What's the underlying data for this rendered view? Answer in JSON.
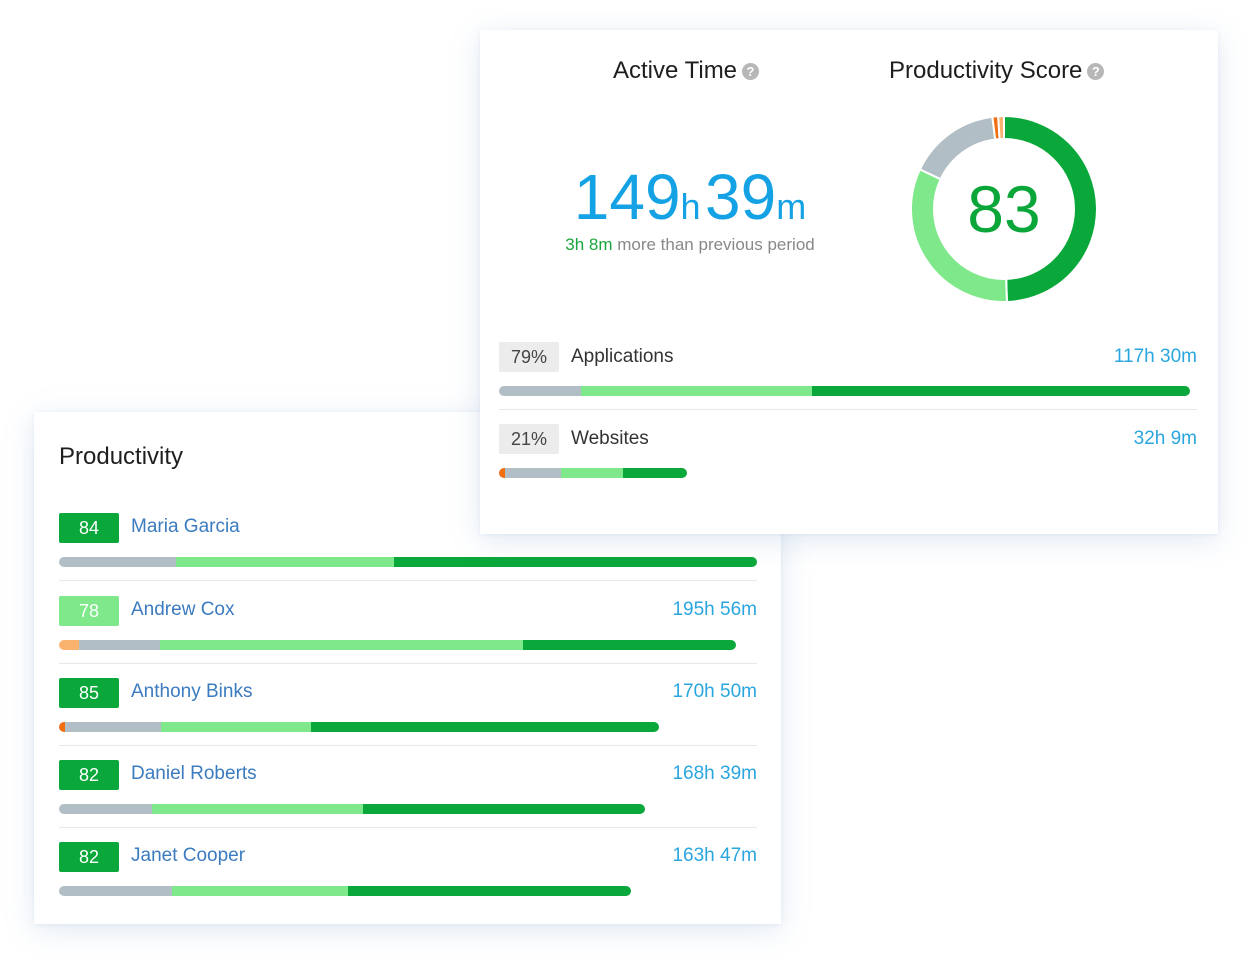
{
  "colors": {
    "neutral": "#b1bec5",
    "productive_light": "#7ee88a",
    "productive_dark": "#0aa83a",
    "unproductive_light": "#f9b36f",
    "unproductive_dark": "#f06e14",
    "accent_blue": "#2aa6df"
  },
  "productivity": {
    "title": "Productivity",
    "users": [
      {
        "score": "84",
        "score_level": "high",
        "name": "Maria Garcia",
        "time": "",
        "bar": {
          "total": 1.0,
          "segments": [
            {
              "kind": "neutral",
              "share": 0.168
            },
            {
              "kind": "productive_light",
              "share": 0.312
            },
            {
              "kind": "productive_dark",
              "share": 0.52
            }
          ]
        }
      },
      {
        "score": "78",
        "score_level": "medium",
        "name": "Andrew Cox",
        "time": "195h 56m",
        "bar": {
          "total": 0.97,
          "segments": [
            {
              "kind": "unproductive_light",
              "share": 0.03
            },
            {
              "kind": "neutral",
              "share": 0.119
            },
            {
              "kind": "productive_light",
              "share": 0.537
            },
            {
              "kind": "productive_dark",
              "share": 0.314
            }
          ]
        }
      },
      {
        "score": "85",
        "score_level": "high",
        "name": "Anthony Binks",
        "time": "170h 50m",
        "bar": {
          "total": 0.86,
          "segments": [
            {
              "kind": "unproductive_dark",
              "share": 0.01
            },
            {
              "kind": "neutral",
              "share": 0.16
            },
            {
              "kind": "productive_light",
              "share": 0.25
            },
            {
              "kind": "productive_dark",
              "share": 0.58
            }
          ]
        }
      },
      {
        "score": "82",
        "score_level": "high",
        "name": "Daniel Roberts",
        "time": "168h 39m",
        "bar": {
          "total": 0.84,
          "segments": [
            {
              "kind": "neutral",
              "share": 0.159
            },
            {
              "kind": "productive_light",
              "share": 0.36
            },
            {
              "kind": "productive_dark",
              "share": 0.481
            }
          ]
        }
      },
      {
        "score": "82",
        "score_level": "high",
        "name": "Janet Cooper",
        "time": "163h 47m",
        "bar": {
          "total": 0.82,
          "segments": [
            {
              "kind": "neutral",
              "share": 0.197
            },
            {
              "kind": "productive_light",
              "share": 0.308
            },
            {
              "kind": "productive_dark",
              "share": 0.495
            }
          ]
        }
      }
    ]
  },
  "summary": {
    "active_time": {
      "title": "Active Time",
      "help_icon": "question-icon",
      "hours": "149",
      "hours_unit": "h",
      "minutes": "39",
      "minutes_unit": "m",
      "diff_value": "3h 8m",
      "diff_text": " more than previous period"
    },
    "productivity_score": {
      "title": "Productivity Score",
      "help_icon": "question-icon",
      "value": "83",
      "donut_segments": [
        {
          "kind": "productive_dark",
          "share": 0.495
        },
        {
          "kind": "productive_light",
          "share": 0.325
        },
        {
          "kind": "neutral",
          "share": 0.16
        },
        {
          "kind": "unproductive_dark",
          "share": 0.01
        },
        {
          "kind": "unproductive_light",
          "share": 0.01
        }
      ]
    },
    "rows": [
      {
        "pct": "79%",
        "label": "Applications",
        "time": "117h 30m",
        "bar": {
          "total": 0.99,
          "segments": [
            {
              "kind": "neutral",
              "share": 0.119
            },
            {
              "kind": "productive_light",
              "share": 0.334
            },
            {
              "kind": "productive_dark",
              "share": 0.547
            }
          ]
        }
      },
      {
        "pct": "21%",
        "label": "Websites",
        "time": "32h 9m",
        "bar": {
          "total": 0.27,
          "segments": [
            {
              "kind": "unproductive_dark",
              "share": 0.03
            },
            {
              "kind": "neutral",
              "share": 0.3
            },
            {
              "kind": "productive_light",
              "share": 0.33
            },
            {
              "kind": "productive_dark",
              "share": 0.34
            }
          ]
        }
      }
    ]
  }
}
